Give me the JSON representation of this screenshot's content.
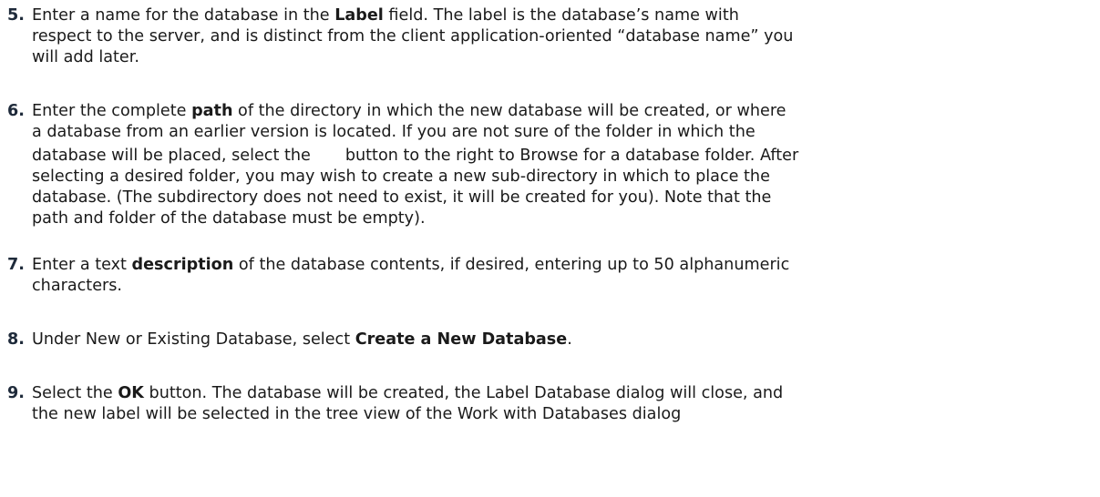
{
  "steps": [
    {
      "number": "5.",
      "lines": [
        [
          "Enter a name for the database in the ",
          "Label",
          " field. The label is the database’s name with"
        ],
        [
          "respect to the server, and is distinct from the client application-oriented “database name” you"
        ],
        [
          "will add later."
        ]
      ]
    },
    {
      "number": "6.",
      "lines": [
        [
          "Enter the complete ",
          "path",
          " of the directory in which the new database will be created, or where"
        ],
        [
          "a database from an earlier version is located. If you are not sure of the folder in which the"
        ],
        [
          "database will be placed, select the",
          "button to the right to Browse for a database folder. After"
        ],
        [
          "selecting a desired folder, you may wish to create a new sub-directory in which to place the"
        ],
        [
          "database. (The subdirectory does not need to exist, it will be created for you). Note that the"
        ],
        [
          "path and folder of the database must be empty)."
        ]
      ]
    },
    {
      "number": "7.",
      "lines": [
        [
          "Enter a text ",
          "description",
          " of the database contents, if desired, entering up to 50 alphanumeric"
        ],
        [
          "characters."
        ]
      ]
    },
    {
      "number": "8.",
      "lines": [
        [
          "Under New or Existing Database, select ",
          "Create a New Database",
          "."
        ]
      ]
    },
    {
      "number": "9.",
      "lines": [
        [
          "Select the ",
          "OK",
          " button. The database will be created, the Label Database dialog will close, and"
        ],
        [
          "the new label will be selected in the tree view of the Work with Databases dialog"
        ]
      ]
    }
  ]
}
